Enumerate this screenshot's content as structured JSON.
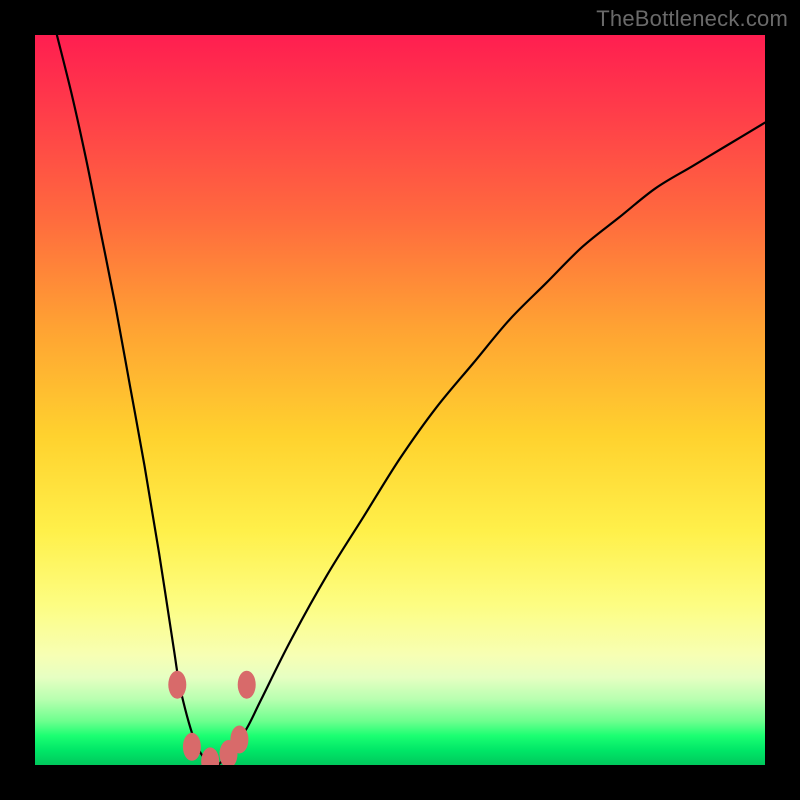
{
  "watermark": "TheBottleneck.com",
  "colors": {
    "frame": "#000000",
    "curve": "#000000",
    "marker": "#d86a6a",
    "gradient_top": "#ff1e50",
    "gradient_bottom": "#00c85c"
  },
  "chart_data": {
    "type": "line",
    "title": "",
    "xlabel": "",
    "ylabel": "",
    "xlim": [
      0,
      100
    ],
    "ylim": [
      0,
      100
    ],
    "description": "V-shaped bottleneck percentage curve rendered over a red-to-green vertical gradient. Curve bottom (optimal pairing) sits near x≈24 at y≈0; values rise steeply on both sides.",
    "series": [
      {
        "name": "bottleneck-curve",
        "x": [
          3,
          5,
          7,
          9,
          11,
          13,
          15,
          17,
          19,
          20,
          22,
          24,
          25,
          27,
          29,
          31,
          35,
          40,
          45,
          50,
          55,
          60,
          65,
          70,
          75,
          80,
          85,
          90,
          95,
          100
        ],
        "values": [
          100,
          92,
          83,
          73,
          63,
          52,
          41,
          29,
          16,
          10,
          3,
          0,
          0,
          2,
          5,
          9,
          17,
          26,
          34,
          42,
          49,
          55,
          61,
          66,
          71,
          75,
          79,
          82,
          85,
          88
        ]
      }
    ],
    "markers": [
      {
        "x": 19.5,
        "y": 11
      },
      {
        "x": 21.5,
        "y": 2.5
      },
      {
        "x": 24,
        "y": 0.5
      },
      {
        "x": 26.5,
        "y": 1.5
      },
      {
        "x": 28,
        "y": 3.5
      },
      {
        "x": 29,
        "y": 11
      }
    ]
  }
}
